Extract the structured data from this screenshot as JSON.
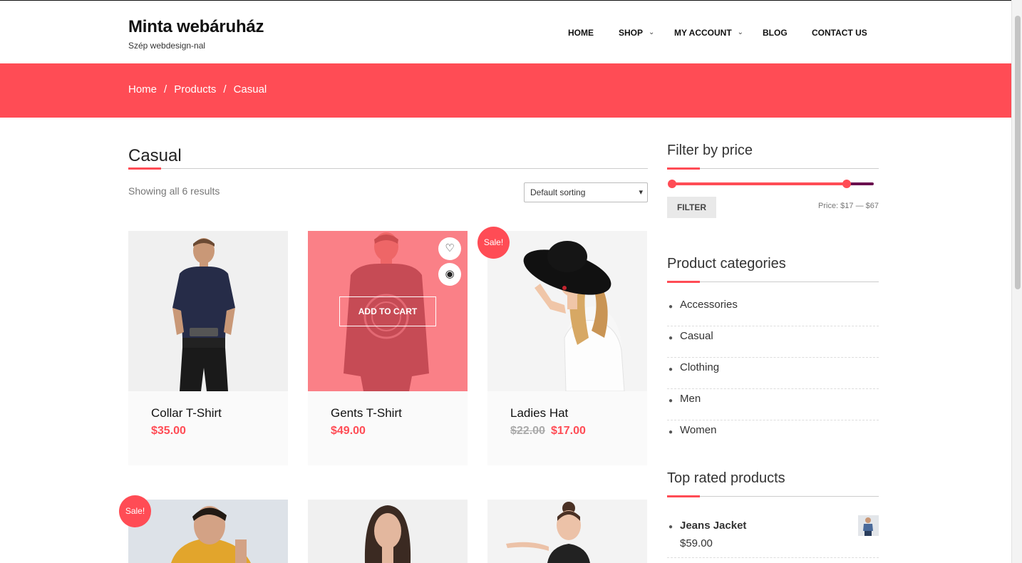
{
  "site": {
    "title": "Minta webáruház",
    "tagline": "Szép webdesign-nal"
  },
  "nav": [
    {
      "label": "HOME",
      "has_dropdown": false
    },
    {
      "label": "SHOP",
      "has_dropdown": true
    },
    {
      "label": "MY ACCOUNT",
      "has_dropdown": true
    },
    {
      "label": "BLOG",
      "has_dropdown": false
    },
    {
      "label": "CONTACT US",
      "has_dropdown": false
    }
  ],
  "breadcrumb": {
    "home": "Home",
    "products": "Products",
    "current": "Casual",
    "separator": "/"
  },
  "page": {
    "title": "Casual",
    "result_count": "Showing all 6 results",
    "sort_selected": "Default sorting"
  },
  "products": [
    {
      "name": "Collar T-Shirt",
      "price": "$35.00",
      "old_price": "",
      "sale": false
    },
    {
      "name": "Gents T-Shirt",
      "price": "$49.00",
      "old_price": "",
      "sale": false,
      "hovered": true,
      "add_to_cart": "ADD TO CART"
    },
    {
      "name": "Ladies Hat",
      "price": "$17.00",
      "old_price": "$22.00",
      "sale": true
    },
    {
      "name": "",
      "price": "",
      "old_price": "",
      "sale": true
    },
    {
      "name": "",
      "price": "",
      "old_price": "",
      "sale": false
    },
    {
      "name": "",
      "price": "",
      "old_price": "",
      "sale": false
    }
  ],
  "sale_label": "Sale!",
  "sidebar": {
    "filter": {
      "title": "Filter by price",
      "button": "FILTER",
      "price_label": "Price: $17 — $67"
    },
    "categories": {
      "title": "Product categories",
      "items": [
        "Accessories",
        "Casual",
        "Clothing",
        "Men",
        "Women"
      ]
    },
    "top_rated": {
      "title": "Top rated products",
      "items": [
        {
          "name": "Jeans Jacket",
          "price": "$59.00"
        }
      ]
    }
  },
  "colors": {
    "accent": "#ff4c55",
    "slider_rest": "#6a0f4e"
  },
  "icons": {
    "wishlist": "heart-icon",
    "quick_view": "eye-icon",
    "dropdown": "chevron-down-icon"
  }
}
